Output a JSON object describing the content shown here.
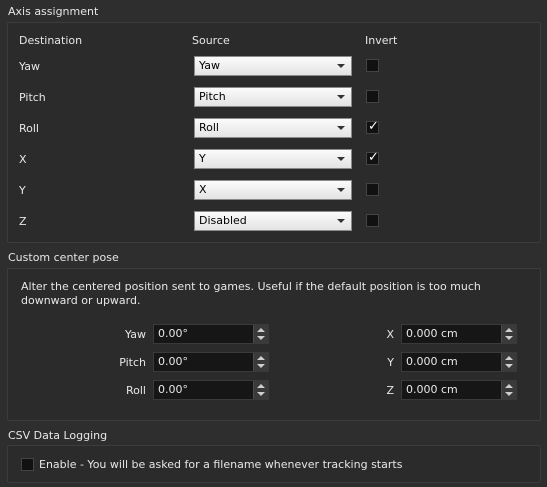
{
  "axis": {
    "title": "Axis assignment",
    "headers": {
      "destination": "Destination",
      "source": "Source",
      "invert": "Invert"
    },
    "rows": [
      {
        "destination": "Yaw",
        "source": "Yaw",
        "invert": false
      },
      {
        "destination": "Pitch",
        "source": "Pitch",
        "invert": false
      },
      {
        "destination": "Roll",
        "source": "Roll",
        "invert": true
      },
      {
        "destination": "X",
        "source": "Y",
        "invert": true
      },
      {
        "destination": "Y",
        "source": "X",
        "invert": false
      },
      {
        "destination": "Z",
        "source": "Disabled",
        "invert": false
      }
    ],
    "check_glyph": "✓"
  },
  "center": {
    "title": "Custom center pose",
    "description": "Alter the centered position sent to games. Useful if the default position is too much downward or upward.",
    "rotation": [
      {
        "label": "Yaw",
        "value": "0.00°"
      },
      {
        "label": "Pitch",
        "value": "0.00°"
      },
      {
        "label": "Roll",
        "value": "0.00°"
      }
    ],
    "translation": [
      {
        "label": "X",
        "value": "0.000 cm"
      },
      {
        "label": "Y",
        "value": "0.000 cm"
      },
      {
        "label": "Z",
        "value": "0.000 cm"
      }
    ]
  },
  "csv": {
    "title": "CSV Data Logging",
    "enable_label": "Enable - You will be asked for a filename whenever tracking starts",
    "enabled": false
  }
}
